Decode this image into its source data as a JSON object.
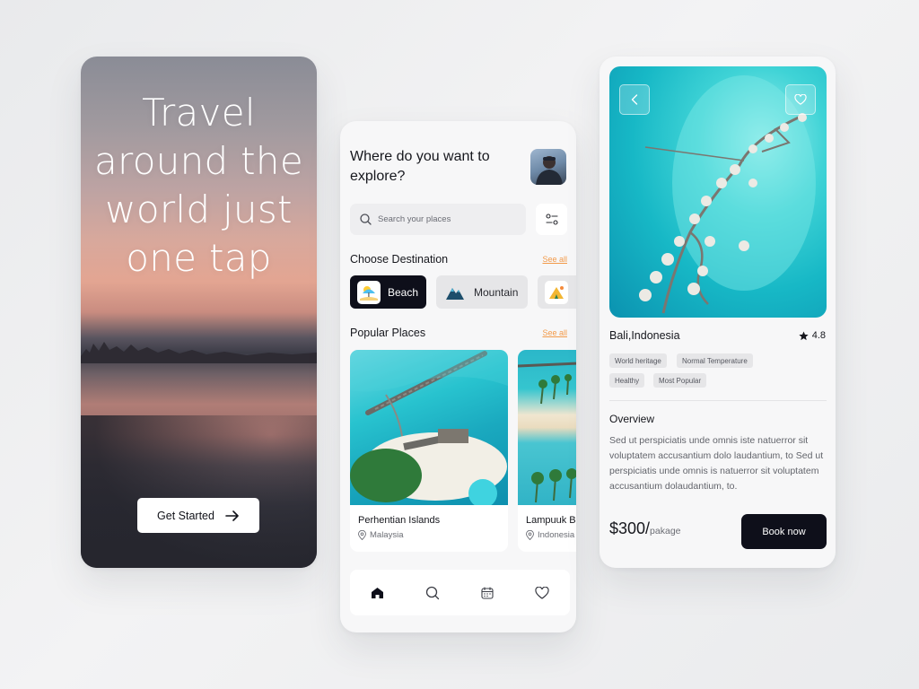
{
  "splash": {
    "hero_title": "Travel around the world just one tap",
    "cta_label": "Get Started",
    "cta_icon": "arrow-right-icon"
  },
  "explore": {
    "title": "Where do you want to explore?",
    "search": {
      "placeholder": "Search your places",
      "value": ""
    },
    "filter_icon": "sliders-icon",
    "destinations": {
      "heading": "Choose Destination",
      "see_all": "See all",
      "items": [
        {
          "label": "Beach",
          "icon": "beach-icon",
          "selected": true
        },
        {
          "label": "Mountain",
          "icon": "mountain-icon",
          "selected": false
        },
        {
          "label": "",
          "icon": "camping-icon",
          "selected": false
        }
      ]
    },
    "popular": {
      "heading": "Popular Places",
      "see_all": "See all",
      "items": [
        {
          "name": "Perhentian Islands",
          "location": "Malaysia"
        },
        {
          "name": "Lampuuk Beach",
          "location": "Indonesia"
        }
      ]
    },
    "nav": [
      "home-icon",
      "search-icon",
      "calendar-icon",
      "heart-icon"
    ]
  },
  "detail": {
    "back_icon": "chevron-left-icon",
    "favorite_icon": "heart-icon",
    "place": "Bali,Indonesia",
    "rating": "4.8",
    "tags": [
      "World heritage",
      "Normal Temperature",
      "Healthy",
      "Most Popular"
    ],
    "overview_title": "Overview",
    "overview_text": "Sed ut perspiciatis unde omnis iste natuerror sit voluptatem accusantium dolo laudantium, to Sed ut perspiciatis unde omnis is natuerror sit voluptatem accusantium dolaudantium, to.",
    "price": "$300/",
    "price_unit": "pakage",
    "book_label": "Book now"
  },
  "colors": {
    "dark": "#0e0f1a",
    "accent": "#f29a4a",
    "background": "#f7f7f8"
  }
}
